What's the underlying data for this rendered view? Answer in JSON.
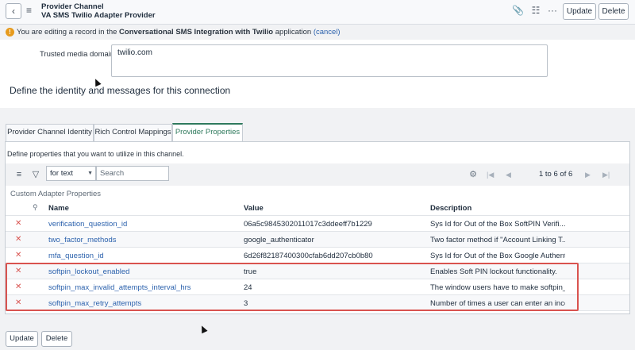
{
  "header": {
    "record_type": "Provider Channel",
    "record_name": "VA SMS Twilio Adapter Provider",
    "update_label": "Update",
    "delete_label": "Delete",
    "icons": [
      "back-icon",
      "hamburger-icon",
      "paperclip-icon",
      "settings-sliders-icon",
      "more-icon"
    ]
  },
  "banner": {
    "prefix": "You are editing a record in the ",
    "app_name": "Conversational SMS Integration with Twilio",
    "suffix": " application ",
    "cancel_link": "(cancel)"
  },
  "form": {
    "trusted_media_label": "Trusted media domains",
    "trusted_media_value": "twilio.com",
    "section_title": "Define the identity and messages for this connection"
  },
  "tabs": [
    {
      "label": "Provider Channel Identity",
      "active": false
    },
    {
      "label": "Rich Control Mappings",
      "active": false
    },
    {
      "label": "Provider Properties",
      "active": true
    }
  ],
  "panel": {
    "description": "Define properties that you want to utilize in this channel.",
    "filter_select": "for text",
    "search_placeholder": "Search",
    "count": "1  to 6 of 6",
    "caption": "Custom Adapter Properties",
    "columns": [
      "Name",
      "Value",
      "Description"
    ],
    "rows": [
      {
        "name": "verification_question_id",
        "value": "06a5c9845302011017c3ddeeff7b1229",
        "description": "Sys Id for Out of the Box SoftPIN Verifi..."
      },
      {
        "name": "two_factor_methods",
        "value": "google_authenticator",
        "description": "Two factor method if \"Account Linking T..."
      },
      {
        "name": "mfa_question_id",
        "value": "6d26f82187400300cfab6dd207cb0b80",
        "description": "Sys Id for Out of the Box Google Authent..."
      },
      {
        "name": "softpin_lockout_enabled",
        "value": "true",
        "description": "Enables Soft PIN lockout functionality."
      },
      {
        "name": "softpin_max_invalid_attempts_interval_hrs",
        "value": "24",
        "description": "The window users have to make softpin_ma..."
      },
      {
        "name": "softpin_max_retry_attempts",
        "value": "3",
        "description": "Number of times a user can enter an inco..."
      }
    ]
  },
  "footer": {
    "update_label": "Update",
    "delete_label": "Delete"
  },
  "colors": {
    "active_tab": "#2f7a5d",
    "link": "#2c62ad",
    "highlight_border": "#d9534f",
    "warning": "#e69a1c"
  }
}
